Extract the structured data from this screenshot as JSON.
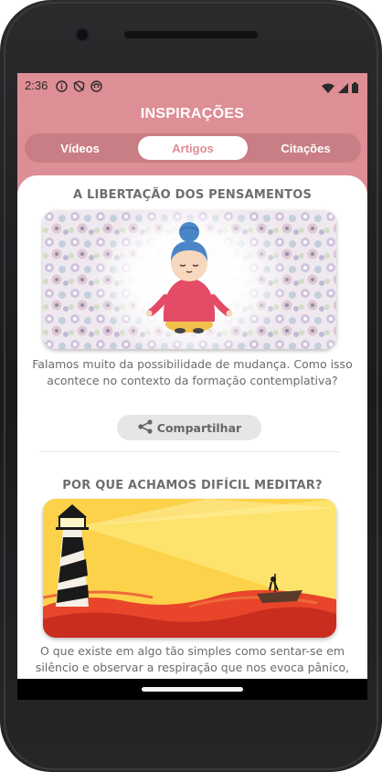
{
  "status_bar": {
    "time": "2:36",
    "left_icons": [
      "info-icon",
      "shield-icon",
      "face-icon"
    ],
    "right_icons": [
      "wifi-icon",
      "signal-icon",
      "battery-icon"
    ]
  },
  "header": {
    "title": "INSPIRAÇÕES"
  },
  "tabs": [
    {
      "label": "Vídeos",
      "active": false
    },
    {
      "label": "Artigos",
      "active": true
    },
    {
      "label": "Citações",
      "active": false
    }
  ],
  "articles": [
    {
      "title": "A LIBERTAÇÃO DOS PENSAMENTOS",
      "description": "Falamos muito da possibilidade de mudança. Como isso acontece no contexto da formação contemplativa?",
      "share_label": "Compartilhar",
      "image": "meditating-woman-illustration"
    },
    {
      "title": "POR QUE ACHAMOS DIFÍCIL MEDITAR?",
      "description": "O que existe em algo tão simples como sentar-se em silêncio e observar a respiração que nos evoca pânico,",
      "image": "lighthouse-boat-illustration"
    }
  ],
  "colors": {
    "primary": "#de8e95",
    "tab_track": "#c97d84",
    "text_gray": "#6b6b6b",
    "button_bg": "#e6e6e6"
  }
}
